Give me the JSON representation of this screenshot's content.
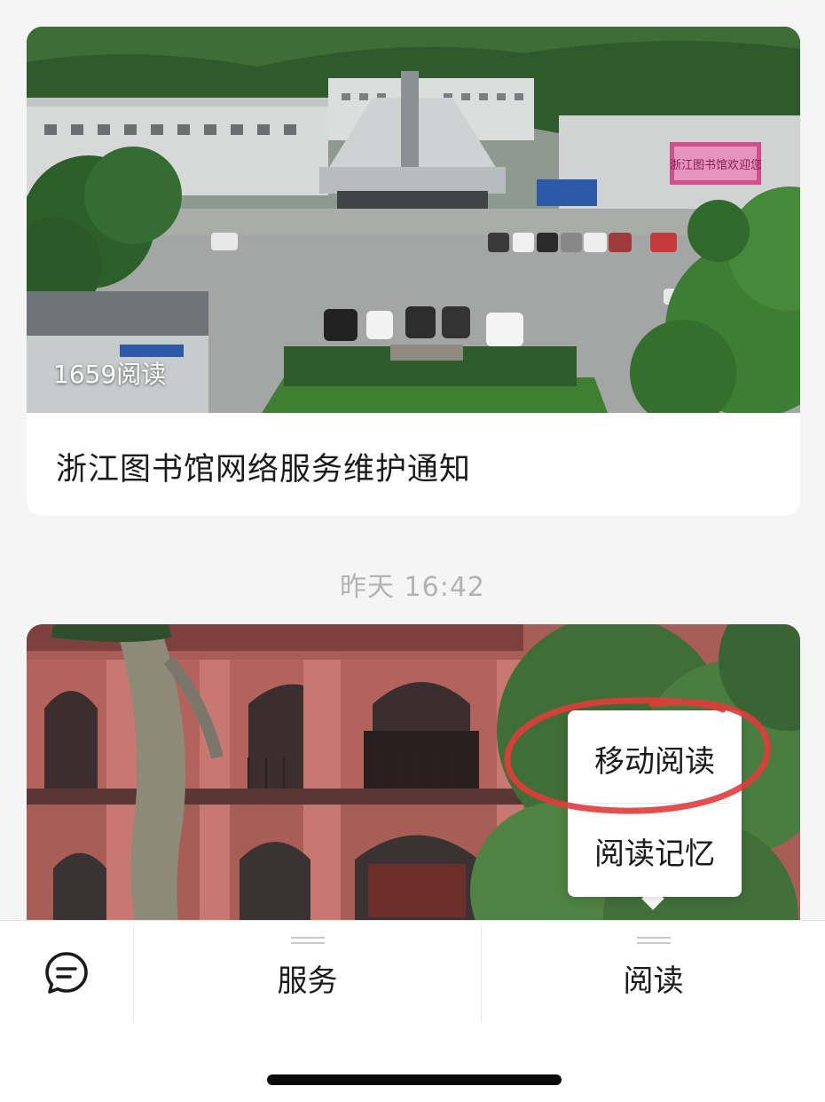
{
  "articles": [
    {
      "read_count": "1659阅读",
      "title": "浙江图书馆网络服务维护通知",
      "banner_text": "浙江图书馆欢迎您"
    }
  ],
  "timestamp": "昨天 16:42",
  "menu": {
    "keyboard_icon": "chat-bubble-icon",
    "items": [
      {
        "label": "服务"
      },
      {
        "label": "阅读"
      }
    ],
    "submenu": [
      {
        "label": "移动阅读"
      },
      {
        "label": "阅读记忆"
      }
    ]
  },
  "colors": {
    "annotation_circle": "#e23b3b",
    "timestamp": "#b3b3b3",
    "background": "#f5f5f5"
  }
}
